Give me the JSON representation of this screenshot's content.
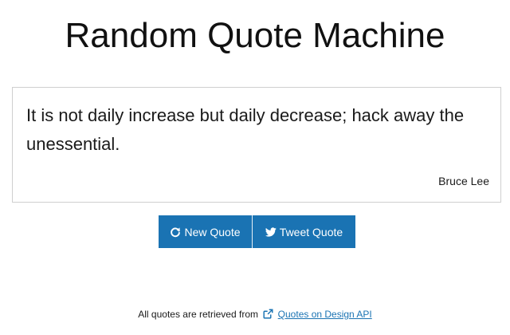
{
  "header": {
    "title": "Random Quote Machine"
  },
  "quote": {
    "text": "It is not daily increase but daily decrease; hack away the unessential.",
    "author": "Bruce Lee"
  },
  "actions": {
    "new_quote_label": "New Quote",
    "new_quote_icon": "refresh-icon",
    "tweet_quote_label": "Tweet Quote",
    "tweet_quote_icon": "twitter-icon"
  },
  "footer": {
    "prefix": "All quotes are retrieved from",
    "link_icon": "external-link-icon",
    "link_label": "Quotes on Design API"
  },
  "colors": {
    "button_bg": "#1a73b3",
    "link": "#1a73b3"
  }
}
